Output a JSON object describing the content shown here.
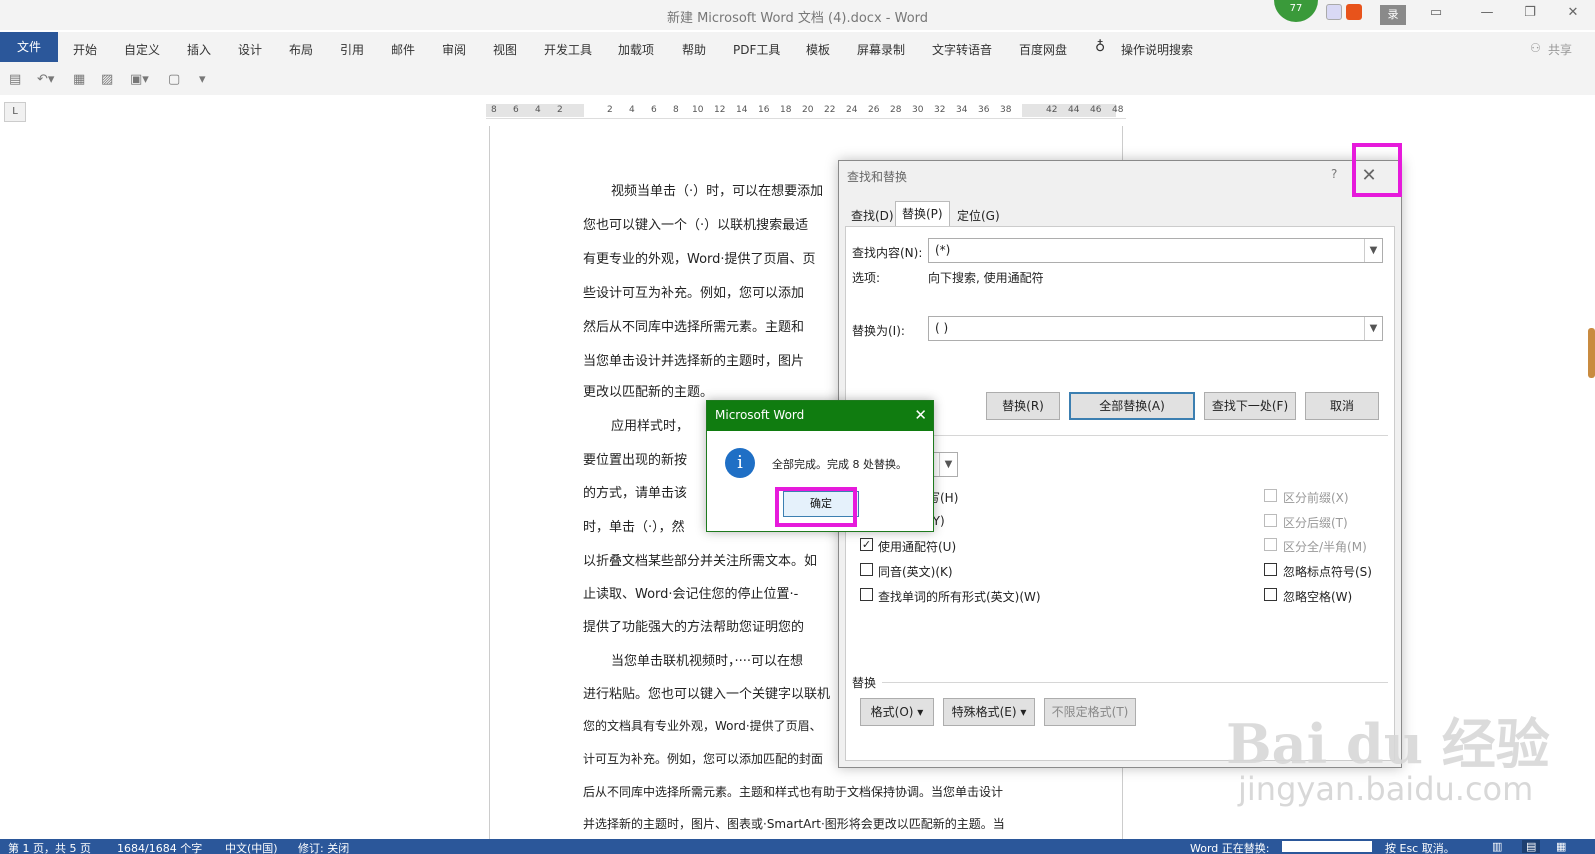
{
  "titlebar": {
    "title": "新建 Microsoft Word 文档 (4).docx  -  Word",
    "badge": "77",
    "login_btn": "录",
    "share": "共享"
  },
  "ribbon": {
    "file": "文件",
    "tabs": [
      "开始",
      "自定义",
      "插入",
      "设计",
      "布局",
      "引用",
      "邮件",
      "审阅",
      "视图",
      "开发工具",
      "加载项",
      "帮助",
      "PDF工具",
      "模板",
      "屏幕录制",
      "文字转语音",
      "百度网盘"
    ],
    "tell_me": "操作说明搜索"
  },
  "ruler": {
    "left_nums": [
      "8",
      "6",
      "4",
      "2"
    ],
    "nums": [
      "2",
      "4",
      "6",
      "8",
      "10",
      "12",
      "14",
      "16",
      "18",
      "20",
      "22",
      "24",
      "26",
      "28",
      "30",
      "32",
      "34",
      "36",
      "38"
    ],
    "right_nums": [
      "42",
      "44",
      "46",
      "48"
    ]
  },
  "document": {
    "lines": [
      "视频当单击（·）时，可以在想要添加",
      "您也可以键入一个（·）以联机搜索最适",
      "有更专业的外观，Word·提供了页眉、页",
      "些设计可互为补充。例如，您可以添加",
      "然后从不同库中选择所需元素。主题和",
      "当您单击设计并选择新的主题时，图片",
      "更改以匹配新的主题。",
      "应用样式时，",
      "要位置出现的新按",
      "的方式，请单击该",
      "时，单击（·），然",
      "以折叠文档某些部分并关注所需文本。如",
      "止读取、Word·会记住您的停止位置·-",
      "提供了功能强大的方法帮助您证明您的",
      "当您单击联机视频时，····可以在想",
      "进行粘贴。您也可以键入一个关键字以联机",
      "您的文档具有专业外观，Word·提供了页眉、",
      "计可互为补充。例如，您可以添加匹配的封面",
      "后从不同库中选择所需元素。主题和样式也有助于文档保持协调。当您单击设计",
      "并选择新的主题时，图片、图表或·SmartArt·图形将会更改以匹配新的主题。当"
    ]
  },
  "find_replace": {
    "title": "查找和替换",
    "help": "?",
    "tabs": [
      "查找(D)",
      "替换(P)",
      "定位(G)"
    ],
    "find_label": "查找内容(N):",
    "find_value": "(*)",
    "options_label": "选项:",
    "options_value": "向下搜索, 使用通配符",
    "replace_label": "替换为(I):",
    "replace_value": "( )",
    "buttons": {
      "replace": "替换(R)",
      "replace_all": "全部替换(A)",
      "find_next": "查找下一处(F)",
      "cancel": "取消"
    },
    "partial_labels": {
      "case": "写(H)",
      "whole": "(Y)"
    },
    "checkboxes_left": [
      {
        "label": "使用通配符(U)",
        "checked": "✓"
      },
      {
        "label": "同音(英文)(K)",
        "checked": ""
      },
      {
        "label": "查找单词的所有形式(英文)(W)",
        "checked": ""
      }
    ],
    "checkboxes_right": [
      {
        "label": "区分前缀(X)",
        "disabled": true
      },
      {
        "label": "区分后缀(T)",
        "disabled": true
      },
      {
        "label": "区分全/半角(M)",
        "disabled": true
      },
      {
        "label": "忽略标点符号(S)",
        "disabled": false
      },
      {
        "label": "忽略空格(W)",
        "disabled": false
      }
    ],
    "replace_section": "替换",
    "format_btn": "格式(O) ▾",
    "special_btn": "特殊格式(E) ▾",
    "no_format_btn": "不限定格式(T)"
  },
  "message_box": {
    "title": "Microsoft Word",
    "icon": "i",
    "text": "全部完成。完成 8 处替换。",
    "ok": "确定"
  },
  "status": {
    "page": "第 1 页，共 5 页",
    "words": "1684/1684 个字",
    "lang": "中文(中国)",
    "track": "修订: 关闭",
    "replacing": "Word 正在替换:",
    "esc": "按 Esc 取消。"
  },
  "watermark": {
    "logo": "Bai du 经验",
    "url": "jingyan.baidu.com"
  },
  "colors": {
    "accent": "#2b579a",
    "msg_title": "#107c10",
    "highlight": "#e61adb"
  }
}
